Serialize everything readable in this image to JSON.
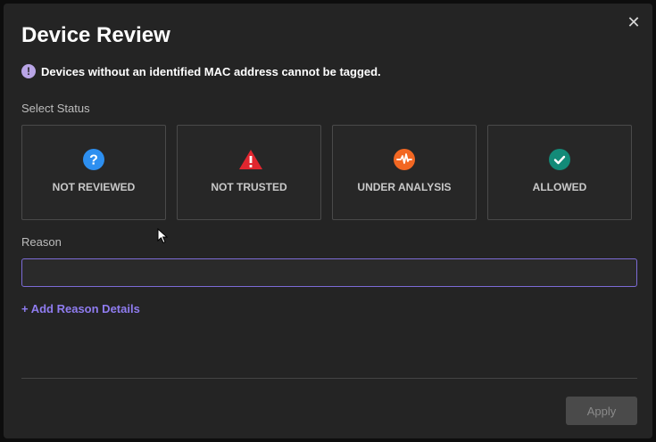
{
  "dialog": {
    "title": "Device Review",
    "close_icon": "close-icon",
    "notice": {
      "icon": "info-icon",
      "text": "Devices without an identified MAC address cannot be tagged."
    }
  },
  "status_section": {
    "label": "Select Status",
    "options": [
      {
        "label": "NOT REVIEWED",
        "icon": "question-circle-icon",
        "color": "#2d8ff0"
      },
      {
        "label": "NOT TRUSTED",
        "icon": "warning-triangle-icon",
        "color": "#e0262f"
      },
      {
        "label": "UNDER ANALYSIS",
        "icon": "activity-pulse-icon",
        "color": "#f26722"
      },
      {
        "label": "ALLOWED",
        "icon": "check-circle-icon",
        "color": "#138a78"
      }
    ]
  },
  "reason": {
    "label": "Reason",
    "value": "",
    "placeholder": "",
    "add_details_label": "+ Add Reason Details"
  },
  "footer": {
    "apply_label": "Apply"
  },
  "colors": {
    "accent": "#8f7cf0",
    "background": "#242424",
    "card_border": "#4a4a4a"
  }
}
